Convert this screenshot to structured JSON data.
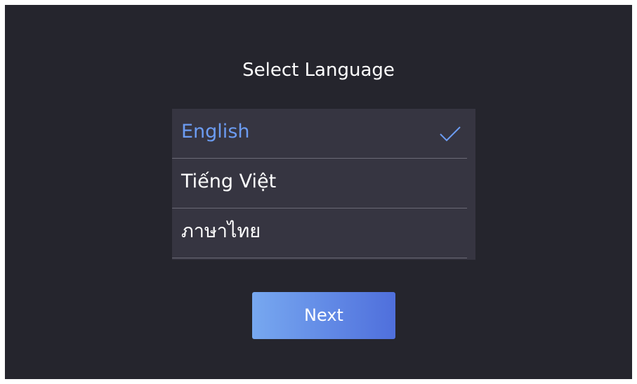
{
  "screen": {
    "title": "Select Language",
    "languages": [
      {
        "label": "English",
        "selected": true
      },
      {
        "label": "Tiếng Việt",
        "selected": false
      },
      {
        "label": "ภาษาไทย",
        "selected": false
      }
    ],
    "next_label": "Next"
  },
  "colors": {
    "background": "#25252d",
    "list_background": "#363541",
    "selected_text": "#6c9cf2",
    "button_gradient_start": "#77a8f0",
    "button_gradient_end": "#4f6fdc"
  },
  "icons": {
    "selected_marker": "check-icon"
  }
}
